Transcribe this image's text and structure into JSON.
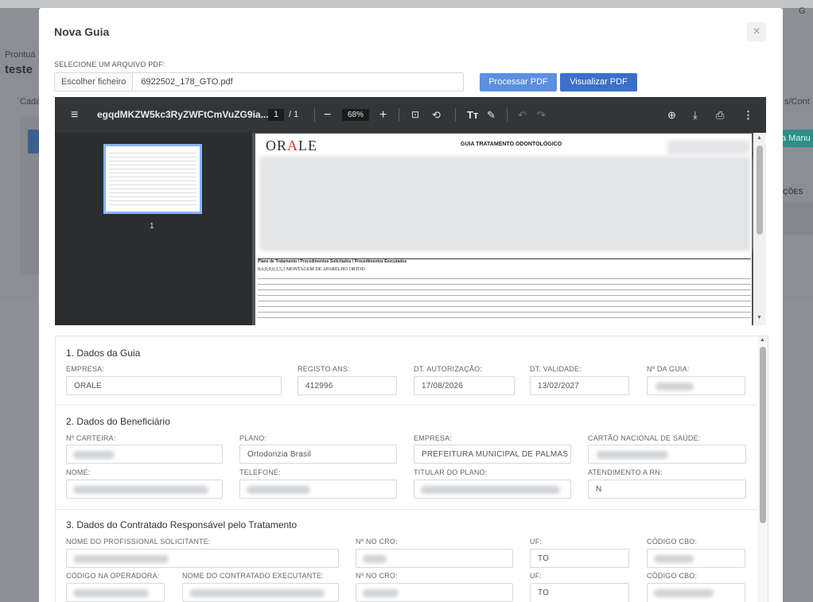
{
  "background": {
    "texts": [
      "Prontuá",
      "teste",
      "Cada",
      "s/Cont",
      "a Manu",
      "ÇÕES",
      "G"
    ]
  },
  "modal": {
    "title": "Nova Guia",
    "close_icon": "×",
    "file_label": "SELECIONE UM ARQUIVO PDF:",
    "file_choose": "Escolher ficheiro",
    "file_name": "6922502_178_GTO.pdf",
    "process_button": "Processar PDF",
    "view_button": "Visualizar PDF"
  },
  "pdf": {
    "file_title": "egqdMKZW5kc3RyZWFtCmVuZG9ia...",
    "current_page": "1",
    "total_pages": "/ 1",
    "zoom": "68%",
    "thumb_number": "1",
    "doc_logo": "ORALE",
    "doc_heading": "GUIA TRATAMENTO ODONTOLÓGICO",
    "section_title": "Plano de Tratamento / Procedimentos Solicitados / Procedimentos Executados",
    "row1_code": "8,6,0,0,0,3,5,3",
    "row1_desc": "MONTAGEM DE APARELHO ORTOD"
  },
  "icons": {
    "menu": "≡",
    "minus": "−",
    "plus": "+",
    "fit": "⊡",
    "rotate": "⟲",
    "text": "Tт",
    "draw": "✎",
    "undo": "↶",
    "redo": "↷",
    "annotate": "⊕",
    "download": "⤓",
    "print": "⎙",
    "more": "⋮"
  },
  "form": {
    "s1": {
      "title": "1. Dados da Guia",
      "empresa_label": "EMPRESA:",
      "empresa_value": "ORALE",
      "ans_label": "REGISTO ANS:",
      "ans_value": "412996",
      "autorizacao_label": "DT. AUTORIZAÇÃO:",
      "autorizacao_value": "17/08/2026",
      "validade_label": "DT. VALIDADE:",
      "validade_value": "13/02/2027",
      "guia_label": "Nº DA GUIA:"
    },
    "s2": {
      "title": "2. Dados do Beneficiário",
      "carteira_label": "Nº CARTEIRA:",
      "plano_label": "PLANO:",
      "plano_value": "Ortodonzia Brasil",
      "empresa_label": "EMPRESA:",
      "empresa_value": "PREFEITURA MUNICIPAL DE PALMAS",
      "cartao_label": "CARTÃO NACIONAL DE SAÚDE:",
      "nome_label": "NOME:",
      "telefone_label": "TELEFONE:",
      "titular_label": "TITULAR DO PLANO:",
      "rn_label": "ATENDIMENTO A RN:",
      "rn_value": "N"
    },
    "s3": {
      "title": "3. Dados do Contratado Responsável pelo Tratamento",
      "solicitante_label": "NOME DO PROFISSIONAL SOLICITANTE:",
      "cro_label": "Nº NO CRO:",
      "uf_label": "UF:",
      "uf_value": "TO",
      "cbo_label": "CÓDIGO CBO:",
      "operadora_label": "CÓDIGO NA OPERADORA:",
      "executante_label": "NOME DO CONTRATADO EXECUTANTE:",
      "cro2_label": "Nº NO CRO:",
      "uf2_label": "UF:",
      "uf2_value": "TO",
      "cbo2_label": "CÓDIGO CBO:"
    }
  }
}
